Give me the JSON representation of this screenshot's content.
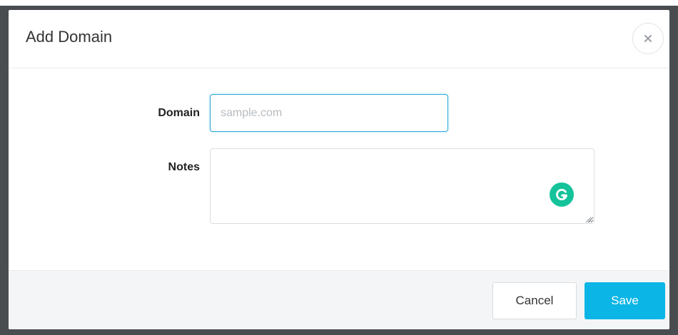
{
  "modal": {
    "title": "Add Domain",
    "close_icon": "close-icon"
  },
  "form": {
    "domain": {
      "label": "Domain",
      "placeholder": "sample.com",
      "value": ""
    },
    "notes": {
      "label": "Notes",
      "value": ""
    },
    "grammarly_icon": "grammarly-icon"
  },
  "footer": {
    "cancel_label": "Cancel",
    "save_label": "Save"
  },
  "colors": {
    "overlay": "#4a4d50",
    "primary": "#0bb5e6",
    "input_focus_border": "#29a8d9",
    "grammarly": "#15c39a",
    "footer_bg": "#f4f5f6"
  }
}
